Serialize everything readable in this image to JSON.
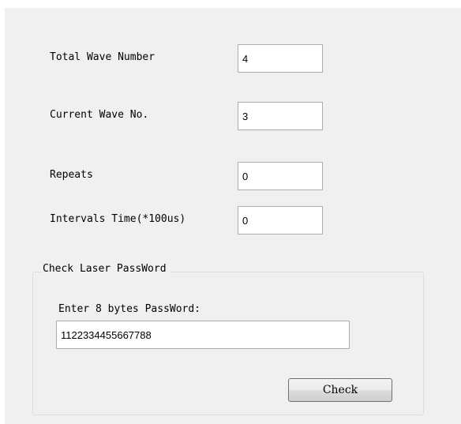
{
  "settings": {
    "total_wave_number": {
      "label": "Total Wave Number",
      "value": "4"
    },
    "current_wave_no": {
      "label": "Current Wave No.",
      "value": "3"
    },
    "repeats": {
      "label": "Repeats",
      "value": "0"
    },
    "intervals_time": {
      "label": "Intervals Time(*100us)",
      "value": "0"
    }
  },
  "password_group": {
    "title": "Check Laser PassWord",
    "prompt": "Enter 8 bytes PassWord:",
    "password_value": "1122334455667788",
    "check_label": "Check"
  }
}
